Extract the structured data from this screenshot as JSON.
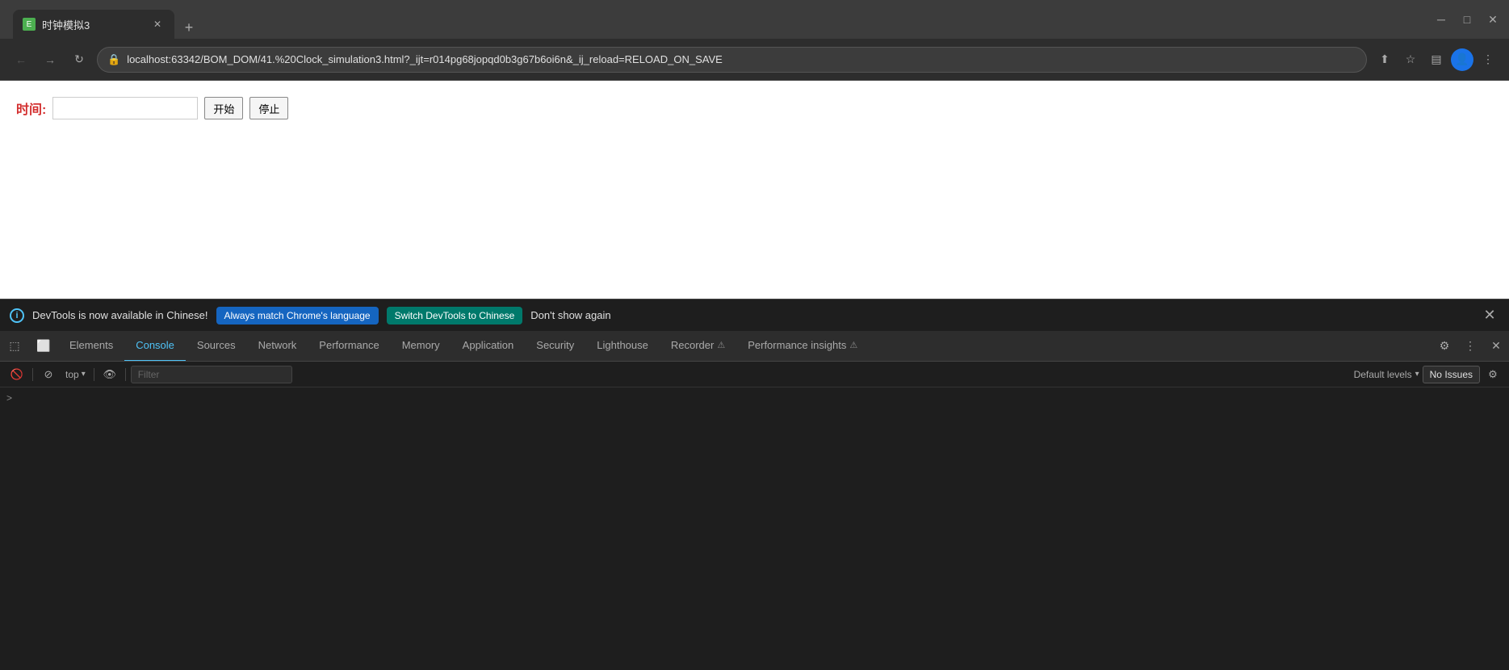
{
  "browser": {
    "tab": {
      "favicon_text": "E",
      "title": "时钟模拟3"
    },
    "new_tab_icon": "+",
    "window_controls": {
      "minimize": "─",
      "maximize": "□",
      "close": "✕"
    },
    "nav": {
      "back": "←",
      "forward": "→",
      "reload": "↻"
    },
    "url": "localhost:63342/BOM_DOM/41.%20Clock_simulation3.html?_ijt=r014pg68jopqd0b3g67b6oi6n&_ij_reload=RELOAD_ON_SAVE",
    "url_lock_icon": "🔒",
    "addr_icons": {
      "share": "⬆",
      "bookmark": "☆",
      "sidebar": "▤",
      "menu": "⋮"
    }
  },
  "page": {
    "time_label": "时间:",
    "time_input_value": "",
    "start_button": "开始",
    "stop_button": "停止"
  },
  "devtools": {
    "notification": {
      "icon": "i",
      "message": "DevTools is now available in Chinese!",
      "btn_match": "Always match Chrome's language",
      "btn_switch": "Switch DevTools to Chinese",
      "btn_dismiss": "Don't show again",
      "close": "✕"
    },
    "tabs": [
      {
        "id": "elements",
        "label": "Elements",
        "active": false
      },
      {
        "id": "console",
        "label": "Console",
        "active": true
      },
      {
        "id": "sources",
        "label": "Sources",
        "active": false
      },
      {
        "id": "network",
        "label": "Network",
        "active": false
      },
      {
        "id": "performance",
        "label": "Performance",
        "active": false
      },
      {
        "id": "memory",
        "label": "Memory",
        "active": false
      },
      {
        "id": "application",
        "label": "Application",
        "active": false
      },
      {
        "id": "security",
        "label": "Security",
        "active": false
      },
      {
        "id": "lighthouse",
        "label": "Lighthouse",
        "active": false
      },
      {
        "id": "recorder",
        "label": "Recorder",
        "active": false
      },
      {
        "id": "performance_insights",
        "label": "Performance insights",
        "active": false
      }
    ],
    "dt_icons": {
      "inspect": "⬚",
      "device": "⬜",
      "settings": "⚙",
      "more": "⋮",
      "close": "✕"
    },
    "console_toolbar": {
      "clear_icon": "🚫",
      "filter_icon": "⊘",
      "context_label": "top",
      "context_chevron": "▾",
      "eye_icon": "👁",
      "filter_placeholder": "Filter",
      "default_levels_label": "Default levels",
      "default_levels_chevron": "▾",
      "no_issues_label": "No Issues",
      "settings_icon": "⚙"
    },
    "console_prompt": ">"
  }
}
